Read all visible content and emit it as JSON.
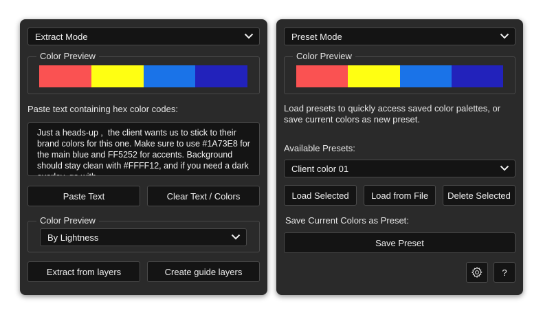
{
  "left_panel": {
    "mode_select": {
      "value": "Extract Mode"
    },
    "preview_group": {
      "label": "Color Preview",
      "swatches": [
        "#fa5252",
        "#ffff12",
        "#1a73e8",
        "#2222bb"
      ]
    },
    "paste_label": "Paste text containing hex color codes:",
    "textarea_value": "Just a heads-up ,  the client wants us to stick to their brand colors for this one. Make sure to use #1A73E8 for the main blue and FF5252 for accents. Background should stay clean with #FFFF12, and if you need a dark overlay, go with",
    "paste_button": "Paste Text",
    "clear_button": "Clear Text / Colors",
    "sort_group": {
      "label": "Color Preview",
      "select_value": "By Lightness"
    },
    "extract_button": "Extract from layers",
    "guide_button": "Create guide layers"
  },
  "right_panel": {
    "mode_select": {
      "value": "Preset Mode"
    },
    "preview_group": {
      "label": "Color Preview",
      "swatches": [
        "#fa5252",
        "#ffff12",
        "#1a73e8",
        "#2222bb"
      ]
    },
    "description": "Load presets to quickly access saved color palettes, or save current colors as new preset.",
    "available_label": "Available Presets:",
    "preset_select": {
      "value": "Client color 01"
    },
    "load_selected_button": "Load Selected",
    "load_file_button": "Load from File",
    "delete_button": "Delete Selected",
    "save_label": "Save Current Colors as Preset:",
    "save_button": "Save Preset",
    "settings_icon": "gear-icon",
    "help_button": "?"
  }
}
